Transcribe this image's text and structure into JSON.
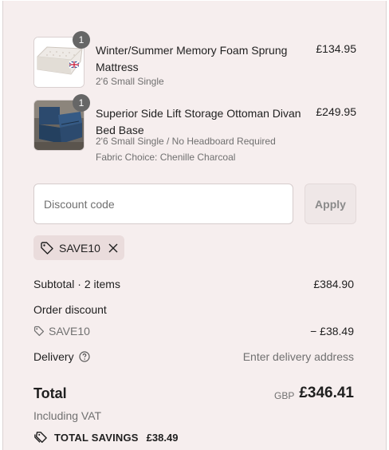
{
  "cart": {
    "items": [
      {
        "quantity": "1",
        "title": "Winter/Summer Memory Foam Sprung Mattress",
        "variant": "2'6 Small Single",
        "price": "£134.95",
        "image": "mattress-image"
      },
      {
        "quantity": "1",
        "title": "Superior Side Lift Storage Ottoman Divan Bed Base",
        "variant": "2'6 Small Single / No Headboard Required",
        "option": "Fabric Choice: Chenille Charcoal",
        "price": "£249.95",
        "image": "ottoman-bed-image"
      }
    ]
  },
  "discount": {
    "placeholder": "Discount code",
    "apply_label": "Apply",
    "applied_code": "SAVE10"
  },
  "summary": {
    "subtotal_label": "Subtotal · 2 items",
    "subtotal_value": "£384.90",
    "order_discount_label": "Order discount",
    "discount_code": "SAVE10",
    "discount_value": "− £38.49",
    "delivery_label": "Delivery",
    "delivery_value": "Enter delivery address",
    "total_label": "Total",
    "currency": "GBP",
    "total_value": "£346.41",
    "vat_note": "Including VAT",
    "savings_label": "TOTAL SAVINGS",
    "savings_value": "£38.49"
  },
  "colors": {
    "panel_bg": "#f6eeee",
    "chip_bg": "#eadcdc",
    "badge_bg": "#666666",
    "mattress_flag": "#c8102e",
    "bed_fabric": "#2c4a6e"
  }
}
